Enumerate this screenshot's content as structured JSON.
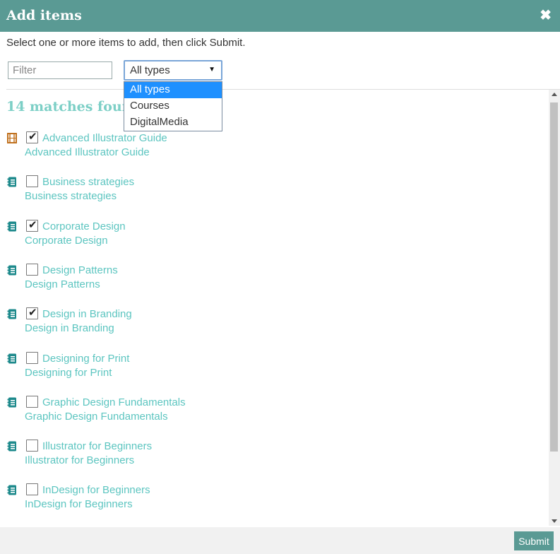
{
  "dialog": {
    "title": "Add items",
    "close_glyph": "✖",
    "instruction": "Select one or more items to add, then click Submit.",
    "filter_placeholder": "Filter",
    "type_select": {
      "value": "All types",
      "options": [
        "All types",
        "Courses",
        "DigitalMedia"
      ],
      "highlighted_option": "All types"
    },
    "matches_text": "14 matches found",
    "items": [
      {
        "name": "Advanced Illustrator Guide",
        "subtitle": "Advanced Illustrator Guide",
        "icon": "film-icon",
        "checked": true
      },
      {
        "name": "Business strategies",
        "subtitle": "Business strategies",
        "icon": "book-icon",
        "checked": false
      },
      {
        "name": "Corporate Design",
        "subtitle": "Corporate Design",
        "icon": "book-icon",
        "checked": true
      },
      {
        "name": "Design Patterns",
        "subtitle": "Design Patterns",
        "icon": "book-icon",
        "checked": false
      },
      {
        "name": "Design in Branding",
        "subtitle": "Design in Branding",
        "icon": "book-icon",
        "checked": true
      },
      {
        "name": "Designing for Print",
        "subtitle": "Designing for Print",
        "icon": "book-icon",
        "checked": false
      },
      {
        "name": "Graphic Design Fundamentals",
        "subtitle": "Graphic Design Fundamentals",
        "icon": "book-icon",
        "checked": false
      },
      {
        "name": "Illustrator for Beginners",
        "subtitle": "Illustrator for Beginners",
        "icon": "book-icon",
        "checked": false
      },
      {
        "name": "InDesign for Beginners",
        "subtitle": "InDesign for Beginners",
        "icon": "book-icon",
        "checked": false
      }
    ],
    "submit_label": "Submit"
  },
  "colors": {
    "header": "#5a9a94",
    "link": "#5cc5c0",
    "matches": "#7ccfc6",
    "dropdown_highlight": "#1e90ff",
    "film_icon": "#c0711f",
    "book_icon": "#1e8a8c"
  }
}
